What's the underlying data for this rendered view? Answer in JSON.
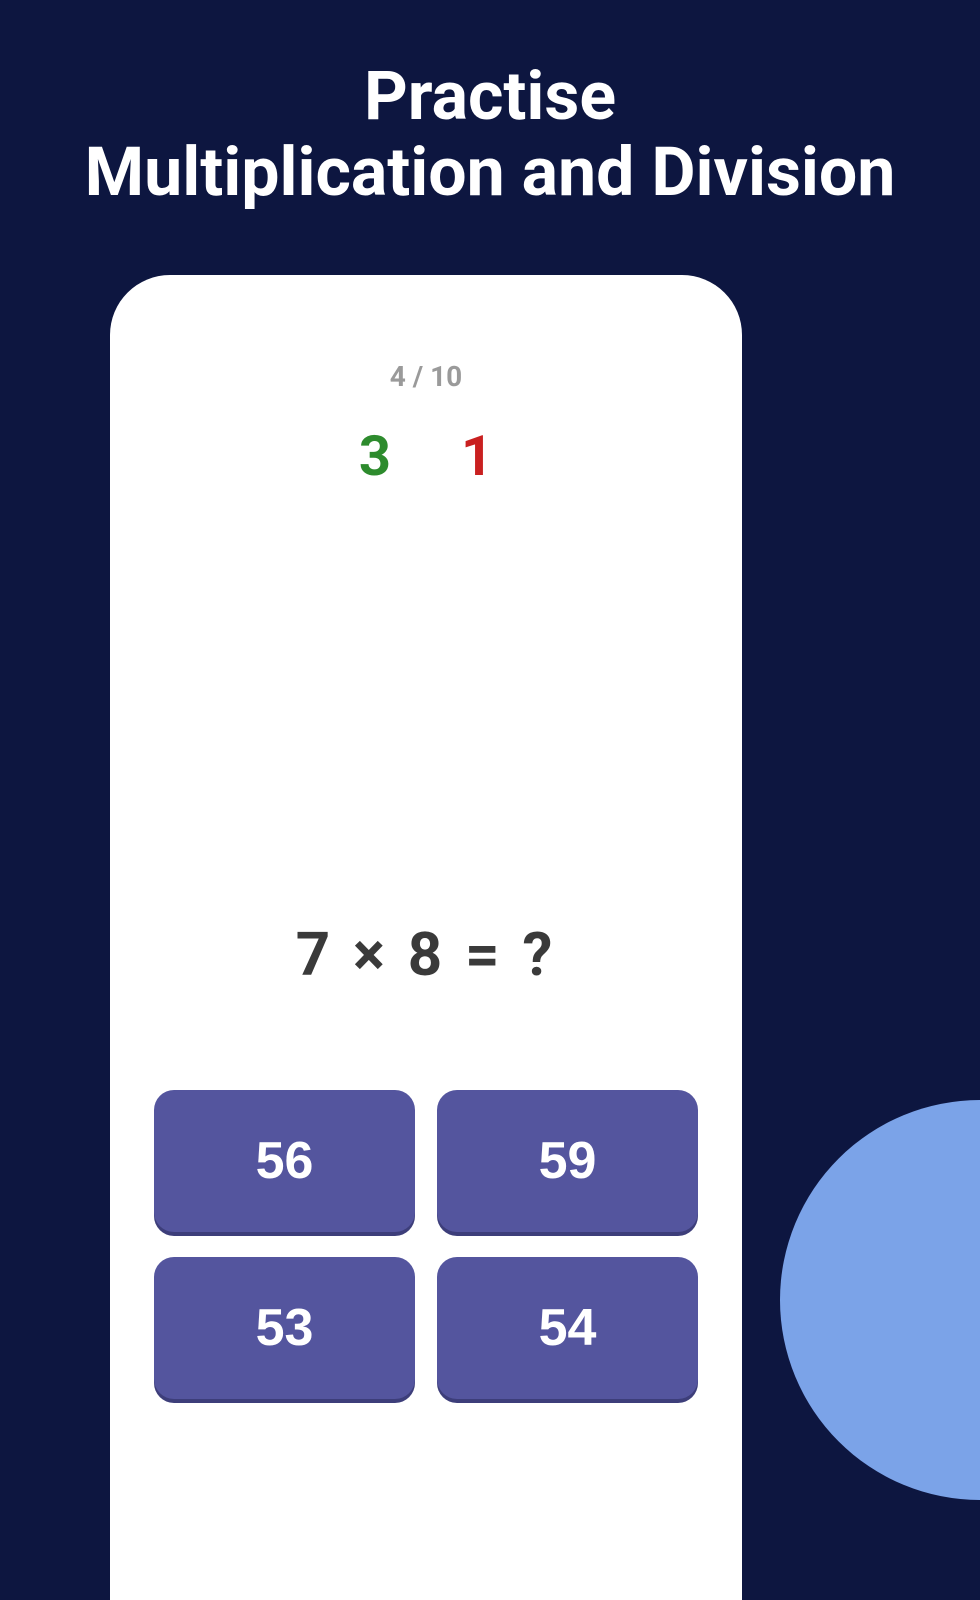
{
  "header": {
    "title_line1": "Practise",
    "title_line2": "Multiplication and Division"
  },
  "quiz": {
    "progress": "4 / 10",
    "score": {
      "correct": "3",
      "incorrect": "1"
    },
    "question": "7 × 8 = ?",
    "answers": [
      "56",
      "59",
      "53",
      "54"
    ]
  },
  "colors": {
    "background": "#0d1640",
    "button": "#54559e",
    "correct": "#2d8b2d",
    "incorrect": "#c92020",
    "accent_circle": "#7ba3e8"
  }
}
